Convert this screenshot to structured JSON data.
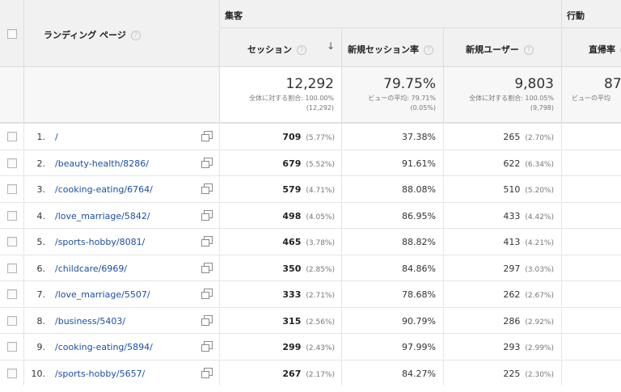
{
  "header": {
    "landing_page_label": "ランディング ページ",
    "acquisition_group": "集客",
    "behavior_group": "行動",
    "sessions_label": "セッション",
    "new_session_rate_label": "新規セッション率",
    "new_users_label": "新規ユーザー",
    "bounce_rate_label": "直帰率"
  },
  "totals": {
    "sessions": {
      "value": "12,292",
      "line1": "全体に対する割合: 100.00%",
      "line2": "(12,292)"
    },
    "new_session_rate": {
      "value": "79.75%",
      "line1": "ビューの平均: 79.71%",
      "line2": "(0.05%)"
    },
    "new_users": {
      "value": "9,803",
      "line1": "全体に対する割合: 100.05%",
      "line2": "(9,798)"
    },
    "bounce_rate": {
      "value": "87",
      "line1": "ビューの平均"
    }
  },
  "rows": [
    {
      "num": "1.",
      "page": "/",
      "sessions": "709",
      "sessions_pct": "(5.77%)",
      "new_rate": "37.38%",
      "users": "265",
      "users_pct": "(2.70%)"
    },
    {
      "num": "2.",
      "page": "/beauty-health/8286/",
      "sessions": "679",
      "sessions_pct": "(5.52%)",
      "new_rate": "91.61%",
      "users": "622",
      "users_pct": "(6.34%)"
    },
    {
      "num": "3.",
      "page": "/cooking-eating/6764/",
      "sessions": "579",
      "sessions_pct": "(4.71%)",
      "new_rate": "88.08%",
      "users": "510",
      "users_pct": "(5.20%)"
    },
    {
      "num": "4.",
      "page": "/love_marriage/5842/",
      "sessions": "498",
      "sessions_pct": "(4.05%)",
      "new_rate": "86.95%",
      "users": "433",
      "users_pct": "(4.42%)"
    },
    {
      "num": "5.",
      "page": "/sports-hobby/8081/",
      "sessions": "465",
      "sessions_pct": "(3.78%)",
      "new_rate": "88.82%",
      "users": "413",
      "users_pct": "(4.21%)"
    },
    {
      "num": "6.",
      "page": "/childcare/6969/",
      "sessions": "350",
      "sessions_pct": "(2.85%)",
      "new_rate": "84.86%",
      "users": "297",
      "users_pct": "(3.03%)"
    },
    {
      "num": "7.",
      "page": "/love_marriage/5507/",
      "sessions": "333",
      "sessions_pct": "(2.71%)",
      "new_rate": "78.68%",
      "users": "262",
      "users_pct": "(2.67%)"
    },
    {
      "num": "8.",
      "page": "/business/5403/",
      "sessions": "315",
      "sessions_pct": "(2.56%)",
      "new_rate": "90.79%",
      "users": "286",
      "users_pct": "(2.92%)"
    },
    {
      "num": "9.",
      "page": "/cooking-eating/5894/",
      "sessions": "299",
      "sessions_pct": "(2.43%)",
      "new_rate": "97.99%",
      "users": "293",
      "users_pct": "(2.99%)"
    },
    {
      "num": "10.",
      "page": "/sports-hobby/5657/",
      "sessions": "267",
      "sessions_pct": "(2.17%)",
      "new_rate": "84.27%",
      "users": "225",
      "users_pct": "(2.30%)"
    }
  ]
}
